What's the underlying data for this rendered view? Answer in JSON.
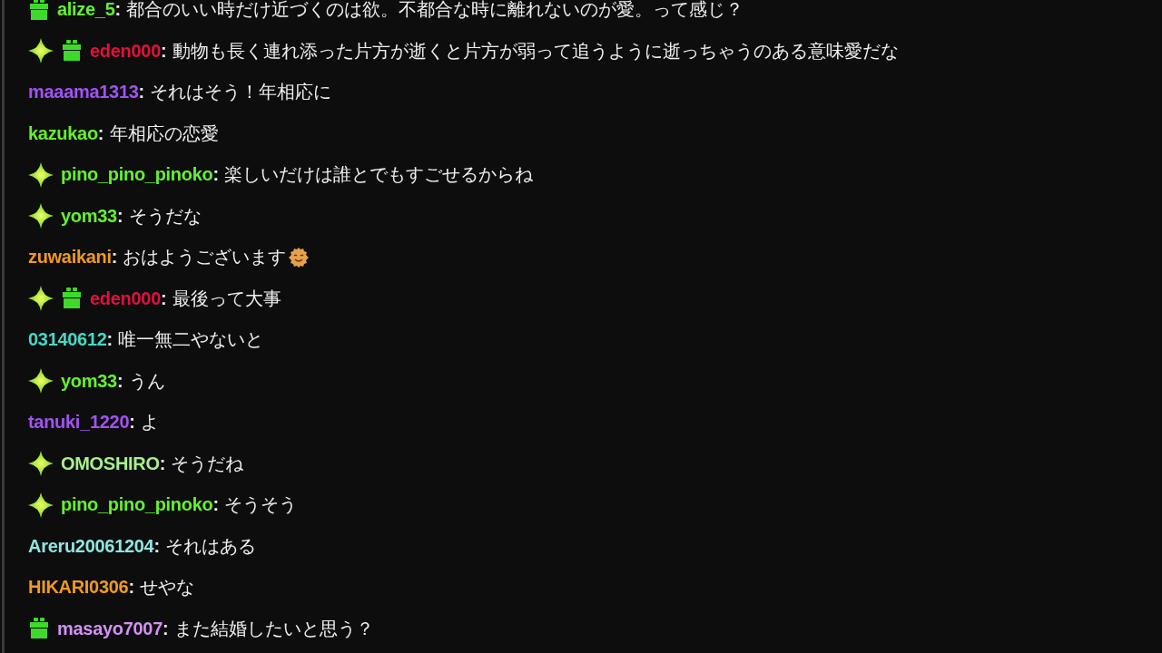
{
  "messages": [
    {
      "badges": [
        {
          "kind": "gift"
        }
      ],
      "user": "alize_5",
      "color": "#63f22e",
      "separator": ":",
      "text": "都合のいい時だけ近づくのは欲。不都合な時に離れないのが愛。って感じ？"
    },
    {
      "badges": [
        {
          "kind": "sparkle"
        },
        {
          "kind": "gift"
        }
      ],
      "user": "eden000",
      "color": "#e3103c",
      "separator": ":",
      "text": "動物も長く連れ添った片方が逝くと片方が弱って追うように逝っちゃうのある意味愛だな"
    },
    {
      "user": "maaama1313",
      "color": "#a352f2",
      "separator": ":",
      "text": "それはそう！年相応に"
    },
    {
      "user": "kazukao",
      "color": "#63f22e",
      "separator": ":",
      "text": "年相応の恋愛"
    },
    {
      "badges": [
        {
          "kind": "sparkle"
        }
      ],
      "user": "pino_pino_pinoko",
      "color": "#63f22e",
      "separator": ":",
      "text": "楽しいだけは誰とでもすごせるからね"
    },
    {
      "badges": [
        {
          "kind": "sparkle"
        }
      ],
      "user": "yom33",
      "color": "#63f22e",
      "separator": ":",
      "text": "そうだな"
    },
    {
      "user": "zuwaikani",
      "color": "#f29a1d",
      "separator": ":",
      "text": "おはようございます",
      "emote": true
    },
    {
      "badges": [
        {
          "kind": "sparkle"
        },
        {
          "kind": "gift"
        }
      ],
      "user": "eden000",
      "color": "#e3103c",
      "separator": ":",
      "text": "最後って大事"
    },
    {
      "user": "03140612",
      "color": "#45d9c4",
      "separator": ":",
      "text": "唯一無二やないと"
    },
    {
      "badges": [
        {
          "kind": "sparkle"
        }
      ],
      "user": "yom33",
      "color": "#63f22e",
      "separator": ":",
      "text": "うん"
    },
    {
      "user": "tanuki_1220",
      "color": "#a352f2",
      "separator": ":",
      "text": "よ"
    },
    {
      "badges": [
        {
          "kind": "sparkle"
        }
      ],
      "user": "OMOSHIRO",
      "color": "#a6f28c",
      "separator": ":",
      "text": "そうだね"
    },
    {
      "badges": [
        {
          "kind": "sparkle"
        }
      ],
      "user": "pino_pino_pinoko",
      "color": "#63f22e",
      "separator": ":",
      "text": "そうそう"
    },
    {
      "user": "Areru20061204",
      "color": "#8fe6e0",
      "separator": ":",
      "text": "それはある"
    },
    {
      "user": "HIKARI0306",
      "color": "#f29a1d",
      "separator": ":",
      "text": "せやな"
    },
    {
      "badges": [
        {
          "kind": "gift"
        }
      ],
      "user": "masayo7007",
      "color": "#d490f5",
      "separator": ":",
      "text": "また結婚したいと思う？"
    }
  ]
}
